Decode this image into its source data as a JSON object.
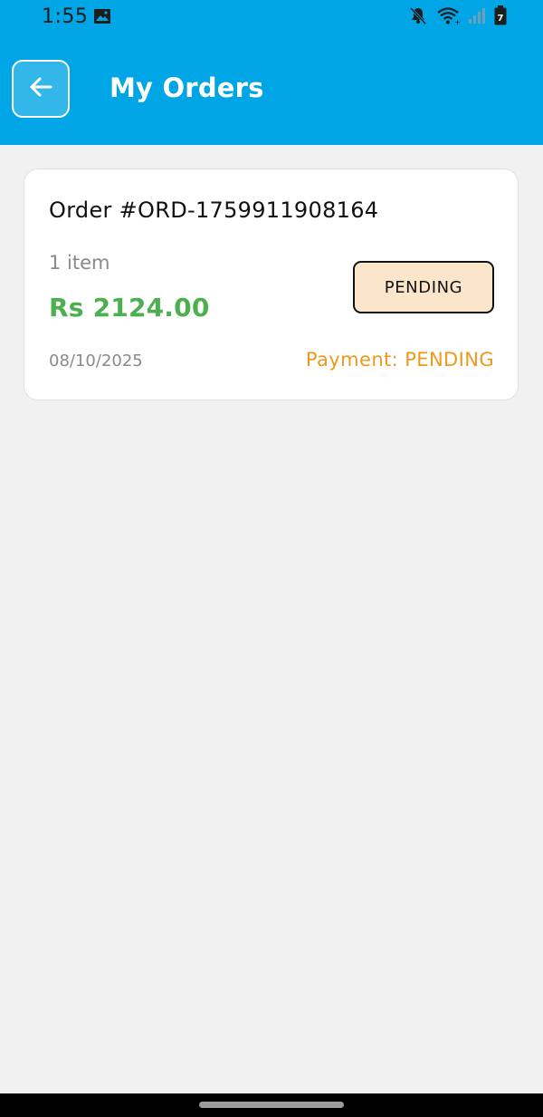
{
  "status_bar": {
    "time": "1:55",
    "battery_level": "7",
    "icons": [
      "image-icon",
      "mute-icon",
      "wifi-icon",
      "signal-icon",
      "battery-icon"
    ]
  },
  "header": {
    "title": "My Orders",
    "back_icon": "arrow-left-icon"
  },
  "orders": [
    {
      "order_id": "Order #ORD-1759911908164",
      "item_count": "1 item",
      "total": "Rs 2124.00",
      "status": "PENDING",
      "date": "08/10/2025",
      "payment": "Payment: PENDING"
    }
  ],
  "colors": {
    "header_bg": "#00a5e6",
    "page_bg": "#f1f1f1",
    "price_green": "#4caf50",
    "payment_orange": "#ec9a1d",
    "badge_bg": "#fbe6cb"
  }
}
